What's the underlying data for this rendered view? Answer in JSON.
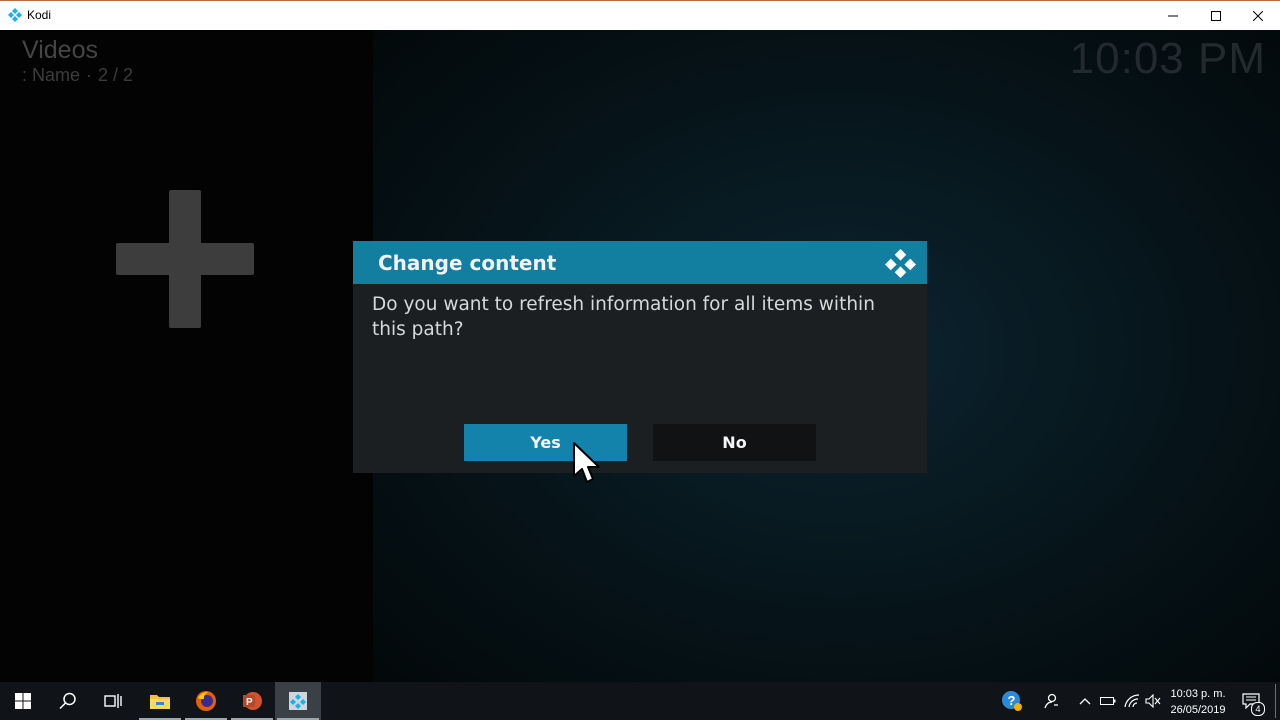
{
  "window": {
    "title": "Kodi"
  },
  "kodi": {
    "section_title": "Videos",
    "sort_label": ": Name",
    "separator": "·",
    "item_count": "2 / 2",
    "clock": "10:03 PM",
    "add_tile_icon": "plus-icon"
  },
  "dialog": {
    "title": "Change content",
    "message": "Do you want to refresh information for all items within this path?",
    "yes_label": "Yes",
    "no_label": "No",
    "accent_color": "#127fa0"
  },
  "taskbar": {
    "icons": [
      "windows-start-icon",
      "search-icon",
      "task-view-icon",
      "file-explorer-icon",
      "firefox-icon",
      "powerpoint-icon",
      "kodi-icon"
    ],
    "tray": {
      "time": "10:03 p. m.",
      "date": "26/05/2019",
      "notification_count": "4"
    }
  }
}
